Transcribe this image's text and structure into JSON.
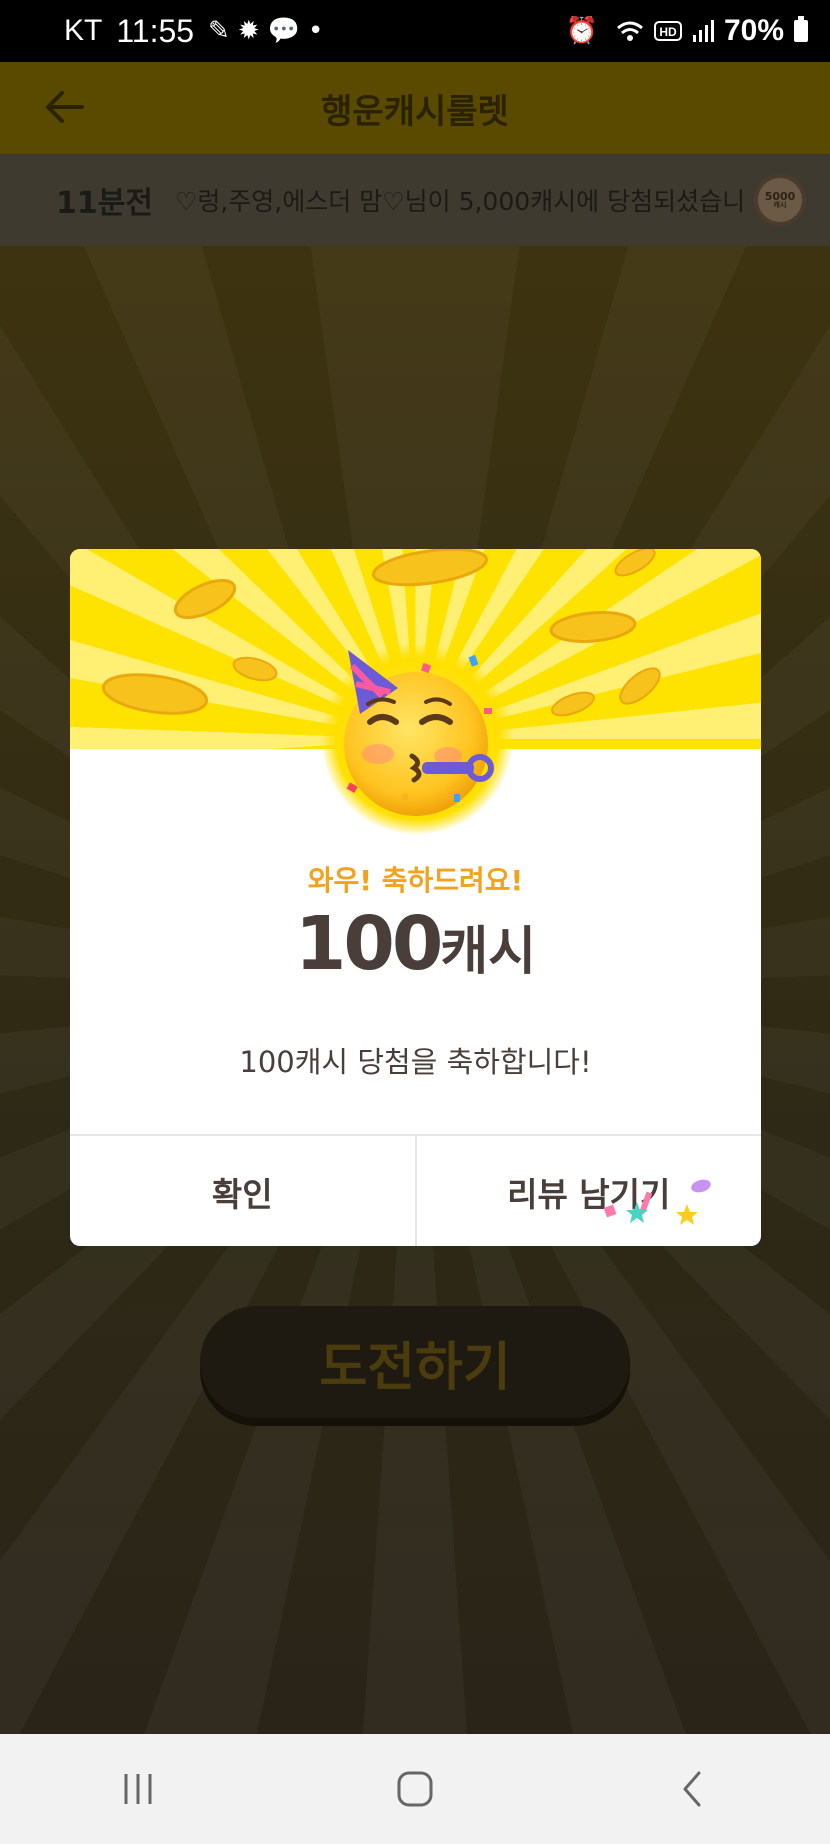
{
  "status_bar": {
    "carrier": "KT",
    "time": "11:55",
    "battery": "70%",
    "icons": [
      "pen-icon",
      "gear-icon",
      "chat-icon",
      "dot-icon",
      "alarm-icon",
      "wifi-icon",
      "hd-icon",
      "signal-icon",
      "battery-icon"
    ]
  },
  "header": {
    "title": "행운캐시룰렛",
    "back_icon": "arrow-left-icon"
  },
  "ticker": {
    "time": "11분전",
    "message": "♡렁,주영,에스더  맘♡님이 5,000캐시에 당첨되셨습니",
    "badge_value": "5000",
    "badge_unit": "캐시"
  },
  "modal": {
    "wow": "와우! 축하드려요!",
    "prize_number": "100",
    "prize_unit": "캐시",
    "description": "100캐시 당첨을 축하합니다!",
    "confirm_label": "확인",
    "review_label": "리뷰 남기기",
    "accent_color": "#f3a21c",
    "banner_color": "#ffe300"
  },
  "main": {
    "challenge_label": "도전하기"
  },
  "nav": {
    "recent_icon": "recent-apps-icon",
    "home_icon": "home-icon",
    "back_icon": "back-icon"
  }
}
